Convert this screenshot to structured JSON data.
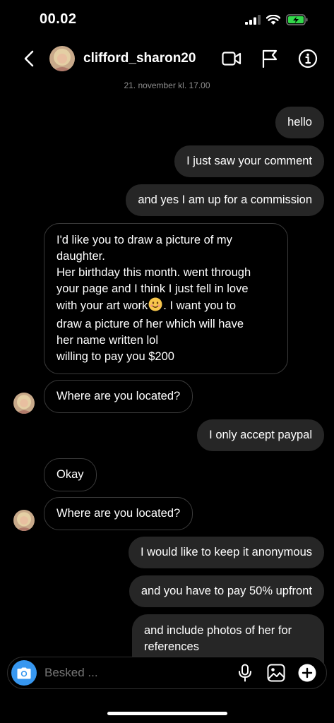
{
  "status_bar": {
    "time": "00.02"
  },
  "header": {
    "username": "clifford_sharon20"
  },
  "date_label": "21. november kl. 17.00",
  "messages": [
    {
      "text": "hello"
    },
    {
      "text": "I just saw your comment"
    },
    {
      "text": "and yes I am up for a commission"
    },
    {
      "lines": [
        "I'd like you to draw a picture of my",
        "daughter.",
        "Her birthday this month. went through",
        "your page and I think I just fell in love",
        "with your art work",
        ". I want you to",
        "draw a picture of her which will have",
        "her name written lol",
        "willing to pay you $200"
      ]
    },
    {
      "text": "Where are you located?"
    },
    {
      "text": "I only accept paypal"
    },
    {
      "text": "Okay"
    },
    {
      "text": "Where are you located?"
    },
    {
      "text": "I would like to keep it anonymous"
    },
    {
      "text": "and you have to pay 50% upfront"
    },
    {
      "lines": [
        "and include photos of her for",
        "references"
      ]
    }
  ],
  "composer": {
    "placeholder": "Besked ..."
  },
  "colors": {
    "accent": "#3797f0",
    "outgoing_bubble": "#262626",
    "background": "#000000"
  }
}
